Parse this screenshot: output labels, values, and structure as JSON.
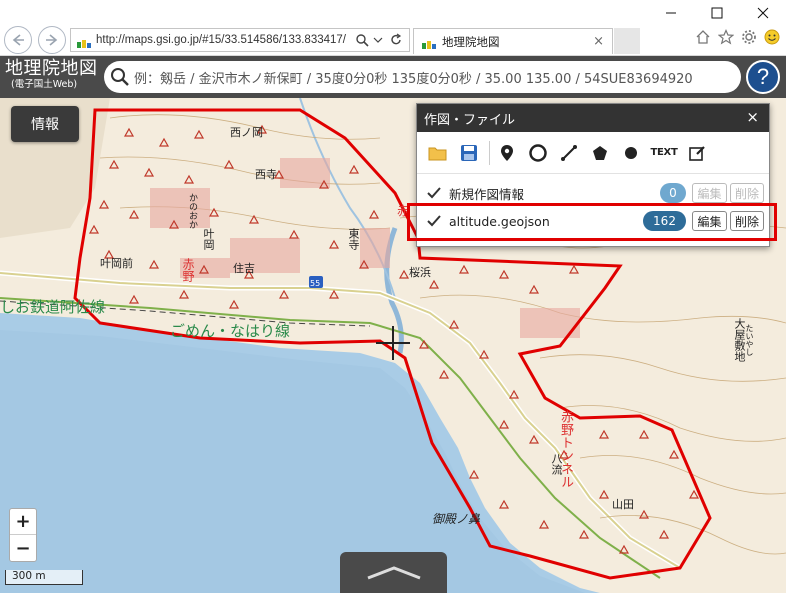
{
  "browser": {
    "url": "http://maps.gsi.go.jp/#15/33.514586/133.833417/",
    "tab_title": "地理院地図",
    "tab_close": "×"
  },
  "header": {
    "logo_main": "地理院地図",
    "logo_sub": "(電子国土Web)",
    "search_placeholder": "例：剱岳 / 金沢市木ノ新保町 / 35度0分0秒 135度0分0秒 / 35.00 135.00 / 54SUE83694920",
    "help_label": "?"
  },
  "info_button": "情報",
  "panel": {
    "title": "作図・ファイル",
    "close": "×",
    "text_tool": "TEXT",
    "rows": [
      {
        "name": "新規作図情報",
        "count": "0",
        "edit": "編集",
        "delete": "削除",
        "active": false
      },
      {
        "name": "altitude.geojson",
        "count": "162",
        "edit": "編集",
        "delete": "削除",
        "active": true
      }
    ]
  },
  "map_labels": {
    "nishinomaru": "西ノ岡",
    "nishitera": "西寺",
    "kanooka": "かのおか",
    "kanooka_kanji": "叶岡",
    "higashidera": "東寺",
    "akano": "赤野",
    "sumiyoshi": "住吉",
    "kanookamae": "叶岡前",
    "sakurahama": "桜浜",
    "railway": "ごめん・なはり線",
    "railway_prefix": "しお鉄道阿佐線",
    "route": "55",
    "akano_tunnel": "赤野トンネル",
    "hachiryu": "八流",
    "yamada": "山田",
    "mitonohana": "御殿ノ鼻",
    "ohyashikichi": "大屋敷地",
    "obayashi_kana": "たいやし",
    "akano_red": "赤"
  },
  "zoom": {
    "plus": "+",
    "minus": "−"
  },
  "scale": "300 m",
  "colors": {
    "accent_red": "#e00000",
    "count_blue": "#2e6c99",
    "header_dark": "#4a4a4a"
  }
}
